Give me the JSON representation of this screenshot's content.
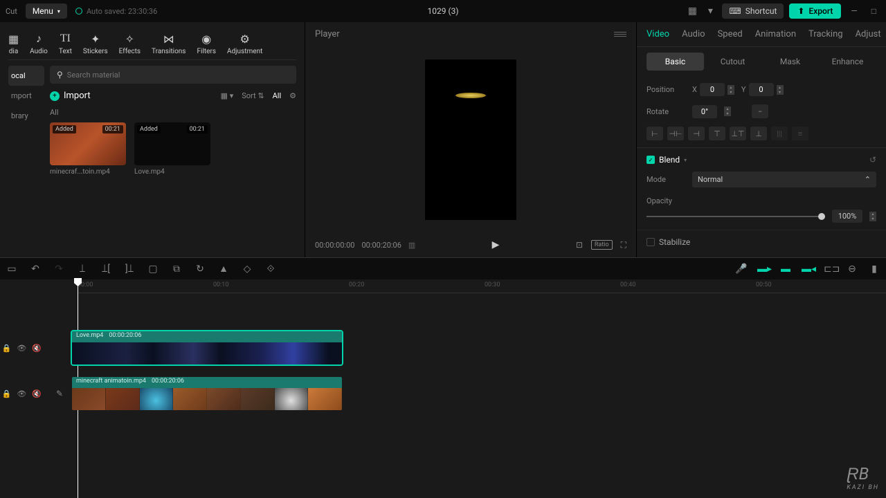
{
  "topbar": {
    "logo": "Cut",
    "menu": "Menu",
    "autosave": "Auto saved: 23:30:36",
    "title": "1029 (3)",
    "shortcut": "Shortcut",
    "export": "Export"
  },
  "nav": {
    "items": [
      {
        "label": "dia",
        "icon": "▦"
      },
      {
        "label": "Audio",
        "icon": "♪"
      },
      {
        "label": "Text",
        "icon": "T"
      },
      {
        "label": "Stickers",
        "icon": "✦"
      },
      {
        "label": "Effects",
        "icon": "✧"
      },
      {
        "label": "Transitions",
        "icon": "⋈"
      },
      {
        "label": "Filters",
        "icon": "◉"
      },
      {
        "label": "Adjustment",
        "icon": "⚙"
      }
    ],
    "side_tabs": [
      "ocal",
      "mport",
      "brary"
    ]
  },
  "media": {
    "search_placeholder": "Search material",
    "import": "Import",
    "sort": "Sort",
    "all": "All",
    "filter_all": "All",
    "items": [
      {
        "added": "Added",
        "dur": "00:21",
        "name": "minecraf...toin.mp4"
      },
      {
        "added": "Added",
        "dur": "00:21",
        "name": "Love.mp4"
      }
    ]
  },
  "player": {
    "title": "Player",
    "time_current": "00:00:00:00",
    "time_duration": "00:00:20:06",
    "ratio": "Ratio"
  },
  "props": {
    "tabs": [
      "Video",
      "Audio",
      "Speed",
      "Animation",
      "Tracking",
      "Adjust"
    ],
    "subtabs": [
      "Basic",
      "Cutout",
      "Mask",
      "Enhance"
    ],
    "position": "Position",
    "x_label": "X",
    "x_val": "0",
    "y_label": "Y",
    "y_val": "0",
    "rotate": "Rotate",
    "rotate_val": "0°",
    "blend": "Blend",
    "mode": "Mode",
    "mode_val": "Normal",
    "opacity": "Opacity",
    "opacity_val": "100%",
    "stabilize": "Stabilize"
  },
  "timeline": {
    "marks": [
      "00:00",
      "00:10",
      "00:20",
      "00:30",
      "00:40",
      "00:50"
    ],
    "clips": [
      {
        "name": "Love.mp4",
        "dur": "00:00:20:06"
      },
      {
        "name": "minecraft animatoin.mp4",
        "dur": "00:00:20:06"
      }
    ]
  },
  "watermark": {
    "main": "ⱤB",
    "sub": "KAZI   BH"
  }
}
